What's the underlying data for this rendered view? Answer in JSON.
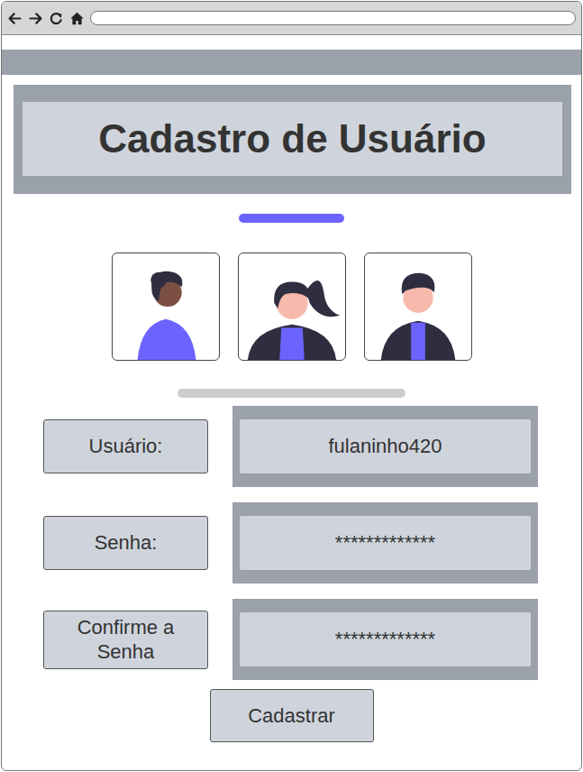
{
  "title": "Cadastro de Usuário",
  "fields": [
    {
      "label": "Usuário:",
      "value": "fulaninho420"
    },
    {
      "label": "Senha:",
      "value": "*************"
    },
    {
      "label": "Confirme a Senha",
      "value": "*************"
    }
  ],
  "submit": "Cadastrar"
}
